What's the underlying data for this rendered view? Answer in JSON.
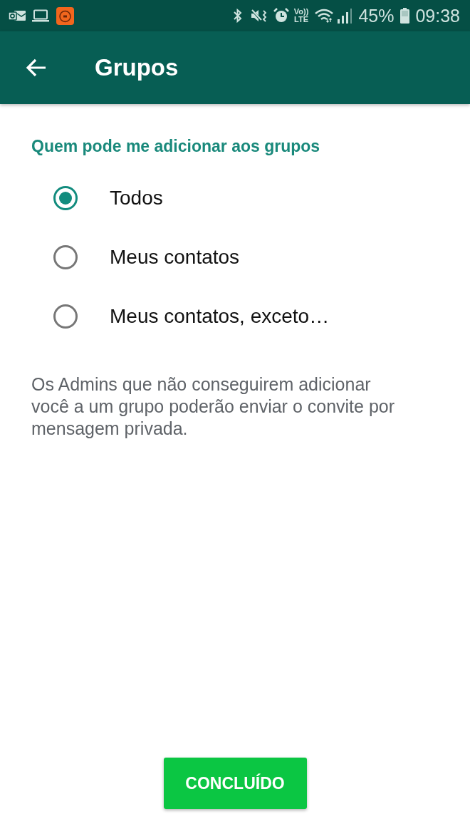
{
  "status_bar": {
    "volte": [
      "Vo))",
      "LTE"
    ],
    "battery": "45%",
    "time": "09:38"
  },
  "toolbar": {
    "title": "Grupos"
  },
  "section": {
    "title": "Quem pode me adicionar aos grupos",
    "options": [
      {
        "label": "Todos",
        "selected": true
      },
      {
        "label": "Meus contatos",
        "selected": false
      },
      {
        "label": "Meus contatos, exceto…",
        "selected": false
      }
    ],
    "description": "Os Admins que não conseguirem adicionar você a um grupo poderão enviar o convite por mensagem privada."
  },
  "button": {
    "label": "CONCLUÍDO"
  }
}
